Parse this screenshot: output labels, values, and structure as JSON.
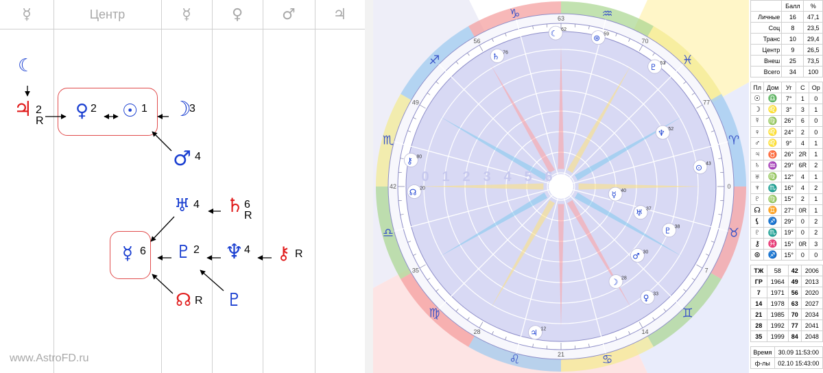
{
  "header": {
    "cols": [
      {
        "label": "☿",
        "glyph": true
      },
      {
        "label": "Центр",
        "glyph": false
      },
      {
        "label": "☿",
        "glyph": true
      },
      {
        "label": "♀",
        "glyph": true
      },
      {
        "label": "♂",
        "glyph": true
      },
      {
        "label": "♃",
        "glyph": true
      }
    ]
  },
  "watermark": "www.AstroFD.ru",
  "left_nodes": {
    "moon_top": {
      "glyph": "☾",
      "sub": ""
    },
    "jupiter": {
      "glyph": "♃",
      "num": "2",
      "r": "R"
    },
    "venus": {
      "glyph": "♀",
      "num": "2"
    },
    "sun": {
      "glyph": "☉",
      "num": "1"
    },
    "moon": {
      "glyph": "☽",
      "num": "3"
    },
    "mars": {
      "glyph": "♂",
      "num": "4"
    },
    "uranus": {
      "glyph": "♅",
      "num": "4"
    },
    "saturn": {
      "glyph": "♄",
      "num": "6",
      "r": "R"
    },
    "mercury": {
      "glyph": "☿",
      "num": "6"
    },
    "pluto": {
      "glyph": "♇",
      "num": "2"
    },
    "neptune": {
      "glyph": "♆",
      "num": "4"
    },
    "chiron": {
      "glyph": "⚷",
      "r": "R"
    },
    "node": {
      "glyph": "☊",
      "r": "R"
    },
    "proserpina": {
      "glyph": "♇"
    }
  },
  "chart": {
    "zodiac": [
      "♑",
      "♒",
      "♓",
      "♈",
      "♉",
      "♊",
      "♋",
      "♌",
      "♍",
      "♎",
      "♏",
      "♐"
    ],
    "degree_marks": [
      "63",
      "70",
      "77",
      "0",
      "7",
      "14",
      "21",
      "28",
      "35",
      "42",
      "49",
      "56"
    ],
    "houses_inner": [
      "0",
      "1",
      "2",
      "3",
      "4",
      "5",
      "6"
    ],
    "planet_labels": [
      {
        "glyph": "☾",
        "v": "62"
      },
      {
        "glyph": "⊛",
        "v": "59"
      },
      {
        "glyph": "♇",
        "v": "53"
      },
      {
        "glyph": "♆",
        "v": "52"
      },
      {
        "glyph": "⊙",
        "v": "43"
      },
      {
        "glyph": "☿",
        "v": "40"
      },
      {
        "glyph": "♅",
        "v": "37"
      },
      {
        "glyph": "♇",
        "v": "38"
      },
      {
        "glyph": "♂",
        "v": "30"
      },
      {
        "glyph": "☽",
        "v": "28"
      },
      {
        "glyph": "♀",
        "v": "33"
      },
      {
        "glyph": "♃",
        "v": "12"
      },
      {
        "glyph": "☊",
        "v": "20"
      },
      {
        "glyph": "♄",
        "v": "76"
      },
      {
        "glyph": "⚷",
        "v": "80"
      }
    ]
  },
  "score_table": {
    "headers": [
      "",
      "Балл",
      "%"
    ],
    "rows": [
      [
        "Личные",
        "16",
        "47,1"
      ],
      [
        "Соц",
        "8",
        "23,5"
      ],
      [
        "Транс",
        "10",
        "29,4"
      ],
      [
        "Центр",
        "9",
        "26,5"
      ],
      [
        "Внеш",
        "25",
        "73,5"
      ],
      [
        "Всего",
        "34",
        "100"
      ]
    ]
  },
  "planet_table": {
    "headers": [
      "Пл",
      "Дом",
      "Уг",
      "С",
      "Ор"
    ],
    "rows": [
      [
        "☉",
        "♎",
        "7°",
        "1",
        "0"
      ],
      [
        "☽",
        "♌",
        "3°",
        "3",
        "1"
      ],
      [
        "☿",
        "♍",
        "26°",
        "6",
        "0"
      ],
      [
        "♀",
        "♌",
        "24°",
        "2",
        "0"
      ],
      [
        "♂",
        "♌",
        "9°",
        "4",
        "1"
      ],
      [
        "♃",
        "♉",
        "26°",
        "2R",
        "1"
      ],
      [
        "♄",
        "♒",
        "29°",
        "6R",
        "2"
      ],
      [
        "♅",
        "♍",
        "12°",
        "4",
        "1"
      ],
      [
        "♆",
        "♏",
        "16°",
        "4",
        "2"
      ],
      [
        "♇",
        "♍",
        "15°",
        "2",
        "1"
      ],
      [
        "☊",
        "♊",
        "27°",
        "0R",
        "1"
      ],
      [
        "⚸",
        "♐",
        "29°",
        "0",
        "2"
      ],
      [
        "♇",
        "♏",
        "19°",
        "0",
        "2"
      ],
      [
        "⚷",
        "♓",
        "15°",
        "0R",
        "3"
      ],
      [
        "⊛",
        "♐",
        "15°",
        "0",
        "0"
      ]
    ]
  },
  "years_table": {
    "rows": [
      [
        "ТЖ",
        "58",
        "42",
        "2006"
      ],
      [
        "ГР",
        "1964",
        "49",
        "2013"
      ],
      [
        "7",
        "1971",
        "56",
        "2020"
      ],
      [
        "14",
        "1978",
        "63",
        "2027"
      ],
      [
        "21",
        "1985",
        "70",
        "2034"
      ],
      [
        "28",
        "1992",
        "77",
        "2041"
      ],
      [
        "35",
        "1999",
        "84",
        "2048"
      ]
    ]
  },
  "time_table": {
    "rows": [
      [
        "Время",
        "30.09 11:53:00"
      ],
      [
        "ф-лы",
        "02.10 15:43:00"
      ]
    ]
  }
}
